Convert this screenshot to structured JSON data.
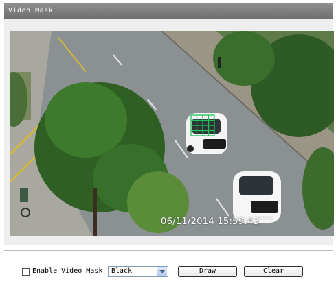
{
  "window": {
    "title": "Video Mask"
  },
  "video": {
    "timestamp": "06/11/2014 15:59:43"
  },
  "controls": {
    "enable_label": "Enable Video Mask",
    "enable_checked": false,
    "color_selected": "Black",
    "draw_label": "Draw",
    "clear_label": "Clear"
  },
  "colors": {
    "titlebar": "#7f7f7f",
    "mask_grid": "#22c35a",
    "panel": "#eeeeee"
  }
}
